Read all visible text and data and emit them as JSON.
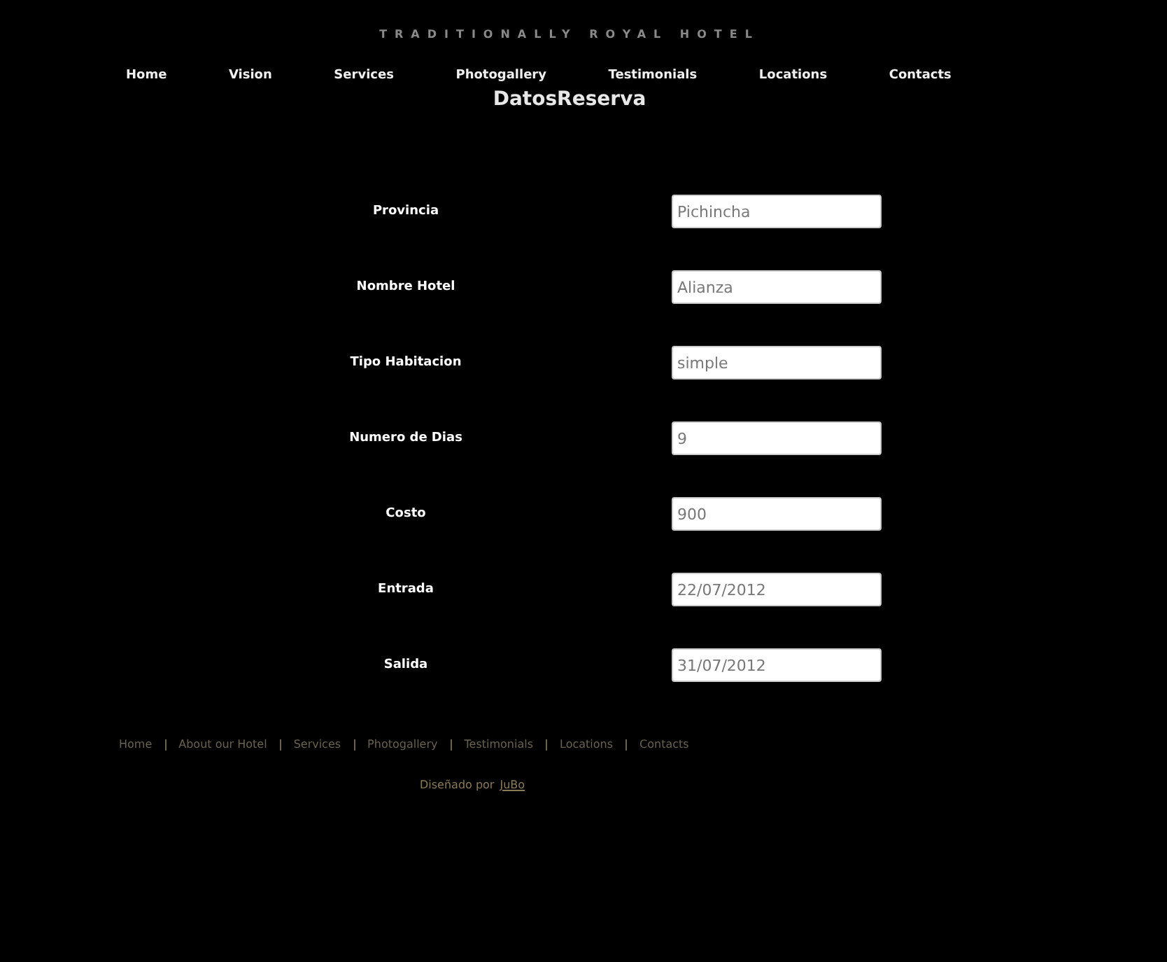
{
  "site_title": "TRADITIONALLY ROYAL HOTEL",
  "nav": [
    {
      "label": "Home"
    },
    {
      "label": "Vision"
    },
    {
      "label": "Services"
    },
    {
      "label": "Photogallery"
    },
    {
      "label": "Testimonials"
    },
    {
      "label": "Locations"
    },
    {
      "label": "Contacts"
    }
  ],
  "heading": "DatosReserva",
  "fields": [
    {
      "label": "Provincia",
      "value": "Pichincha"
    },
    {
      "label": "Nombre Hotel",
      "value": "Alianza"
    },
    {
      "label": "Tipo Habitacion",
      "value": "simple"
    },
    {
      "label": "Numero de Dias",
      "value": "9"
    },
    {
      "label": "Costo",
      "value": "900"
    },
    {
      "label": "Entrada",
      "value": "22/07/2012"
    },
    {
      "label": "Salida",
      "value": "31/07/2012"
    }
  ],
  "footer_links": [
    "Home",
    "About our Hotel",
    "Services",
    "Photogallery",
    "Testimonials",
    "Locations",
    "Contacts"
  ],
  "credit": {
    "text": "Diseñado por",
    "link": "JuBo"
  }
}
